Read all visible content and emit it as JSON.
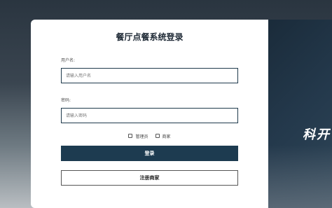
{
  "login": {
    "title": "餐厅点餐系统登录",
    "username_label": "用户名:",
    "username_placeholder": "请输入用户名",
    "password_label": "密码:",
    "password_placeholder": "请输入密码",
    "role_admin": "管理员",
    "role_merchant": "商家",
    "login_button": "登录",
    "register_button": "注册商家"
  },
  "hero": {
    "text": "科开"
  },
  "colors": {
    "primary": "#1d3b50",
    "input_border": "#1f3a4c",
    "card_bg": "#ffffff"
  }
}
